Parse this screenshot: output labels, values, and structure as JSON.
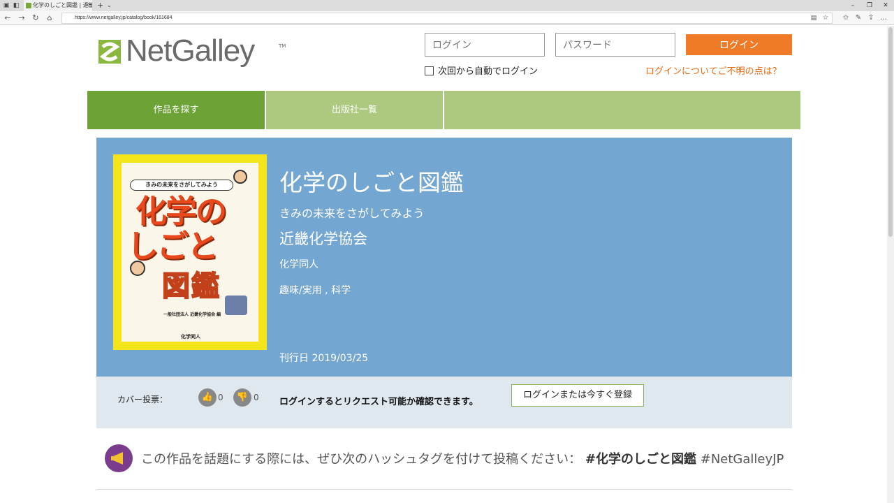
{
  "browser": {
    "tab_title": "化学のしごと図鑑 | 近畿化",
    "url": "https://www.netgalley.jp/catalog/book/161684"
  },
  "header": {
    "logo_text": "NetGalley",
    "login_placeholder": "ログイン",
    "password_placeholder": "パスワード",
    "login_button": "ログイン",
    "remember_label": "次回から自動でログイン",
    "help_link": "ログインについてご不明の点は？"
  },
  "nav": {
    "tabs": [
      {
        "label": "作品を探す",
        "active": true
      },
      {
        "label": "出版社一覧",
        "active": false
      },
      {
        "label": "",
        "active": false
      }
    ]
  },
  "book": {
    "title": "化学のしごと図鑑",
    "subtitle": "きみの未来をさがしてみよう",
    "author": "近畿化学協会",
    "publisher": "化学同人",
    "category": "趣味/実用 , 科学",
    "pub_date_label": "刊行日",
    "pub_date": "2019/03/25",
    "cover": {
      "tagline": "きみの未来をさがしてみよう",
      "line1": "化学の",
      "line2": "しごと",
      "line3": "図鑑",
      "org": "一般社団法人 近畿化学協会 編",
      "publisher": "化学同人"
    }
  },
  "vote": {
    "label": "カバー投票：",
    "up_count": "0",
    "down_count": "0",
    "request_message": "ログインするとリクエスト可能か確認できます。",
    "register_button": "ログインまたは今すぐ登録"
  },
  "hashtag": {
    "prefix": "この作品を話題にする際には、ぜひ次のハッシュタグを付けて投稿ください：",
    "tag1": "#化学のしごと図鑑",
    "tag2": "#NetGalleyJP"
  },
  "colors": {
    "brand_green": "#6da336",
    "light_green": "#acc97f",
    "orange": "#f07b26",
    "panel_blue": "#74a6d2",
    "vote_bg": "#dfe7ef",
    "purple": "#7b3c8e"
  }
}
